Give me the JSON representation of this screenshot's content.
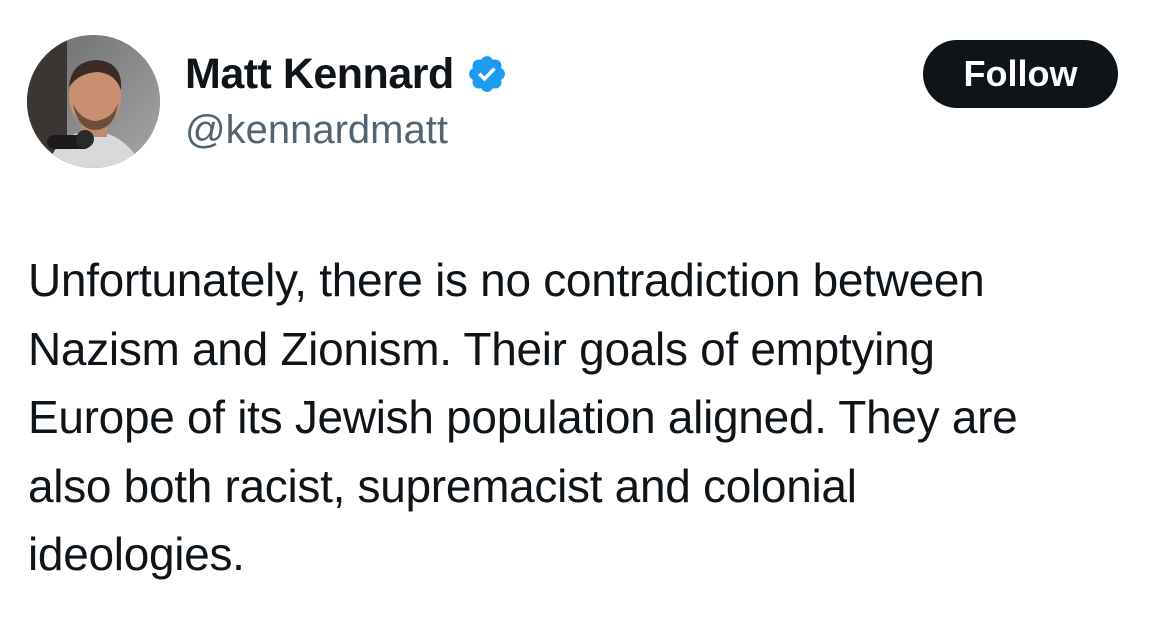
{
  "author": {
    "display_name": "Matt Kennard",
    "handle": "@kennardmatt",
    "verified": true,
    "verified_color": "#1d9bf0",
    "avatar_icon": "profile-photo"
  },
  "actions": {
    "follow_label": "Follow"
  },
  "tweet": {
    "text": "Unfortunately, there is no contradiction between\nNazism and Zionism. Their goals of emptying\nEurope of its Jewish population aligned. They are\nalso both racist, supremacist and colonial\nideologies."
  }
}
